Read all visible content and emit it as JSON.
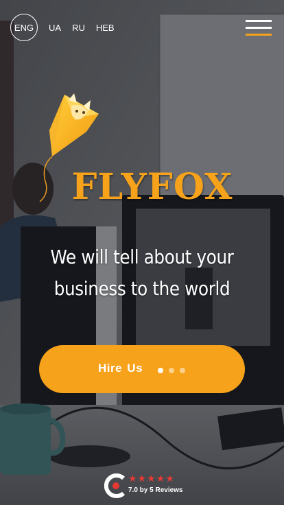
{
  "languages": [
    {
      "label": "ENG",
      "active": true
    },
    {
      "label": "UA",
      "active": false
    },
    {
      "label": "RU",
      "active": false
    },
    {
      "label": "HEB",
      "active": false
    }
  ],
  "brand": {
    "name": "FLYFOX",
    "accent_color": "#f7a21b"
  },
  "hero": {
    "tagline_line1": "We will tell about your",
    "tagline_line2": "business to the world"
  },
  "cta": {
    "label": "Hire Us",
    "slides_total": 3,
    "slide_active": 1
  },
  "clutch": {
    "stars": "★★★★★",
    "rating_text": "7.0 by 5 Reviews",
    "star_color": "#e53935"
  },
  "icons": [
    "hamburger-menu-icon",
    "fox-kite-logo-icon",
    "clutch-logo-icon"
  ]
}
